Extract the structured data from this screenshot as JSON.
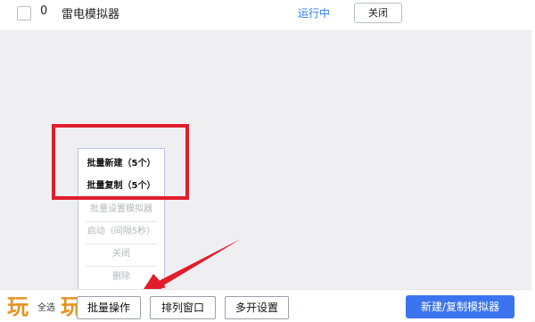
{
  "list": {
    "row": {
      "index": "0",
      "name": "雷电模拟器",
      "status": "运行中",
      "close_label": "关闭"
    }
  },
  "menu": {
    "items": [
      {
        "label": "批量新建（5个）",
        "state": "active"
      },
      {
        "label": "批量复制（5个）",
        "state": "active"
      },
      {
        "label": "批量设置模拟器",
        "state": "disabled"
      },
      {
        "label": "启动（间隔5秒）",
        "state": "disabled"
      },
      {
        "label": "关闭",
        "state": "disabled"
      },
      {
        "label": "删除",
        "state": "disabled"
      }
    ]
  },
  "toolbar": {
    "select_all": "全选",
    "batch_ops": "批量操作",
    "arrange_windows": "排列窗口",
    "multi_settings": "多开设置",
    "new_copy": "新建/复制模拟器"
  },
  "watermark": {
    "logo_char": "玩"
  },
  "colors": {
    "highlight": "#e11d2c",
    "primary": "#3b74ee",
    "status": "#2f7cf6",
    "watermark": "#e6921f"
  }
}
